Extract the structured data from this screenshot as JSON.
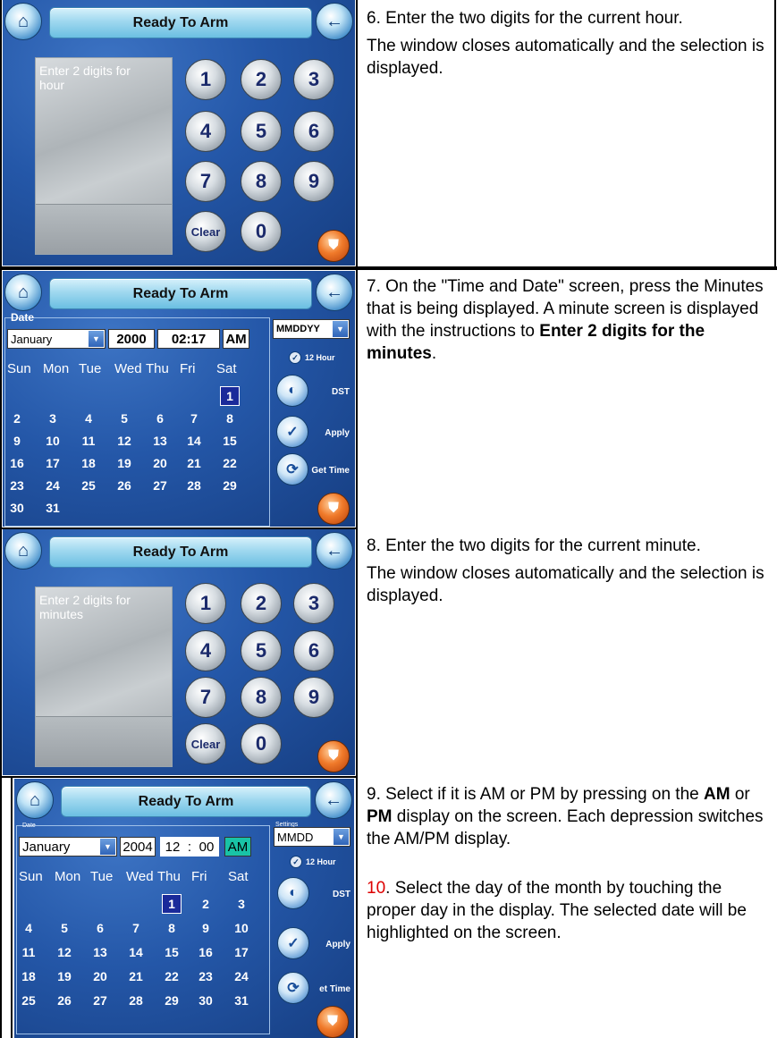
{
  "rows": [
    {
      "screen": {
        "title": "Ready To Arm",
        "prompt": "Enter 2 digits for hour",
        "keys": [
          "1",
          "2",
          "3",
          "4",
          "5",
          "6",
          "7",
          "8",
          "9",
          "Clear",
          "0"
        ]
      },
      "text": [
        "6. Enter the two digits for the current hour.",
        "The window closes automatically and the selection is displayed."
      ]
    },
    {
      "screen": {
        "title": "Ready To Arm",
        "date_caption": "Date",
        "month": "January",
        "year": "2000",
        "time": "02:17",
        "ampm": "AM",
        "format": "MMDDYY",
        "hour_mode": "12 Hour",
        "dow": [
          "Sun",
          "Mon",
          "Tue",
          "Wed",
          "Thu",
          "Fri",
          "Sat"
        ],
        "days": [
          "1",
          "2",
          "3",
          "4",
          "5",
          "6",
          "7",
          "8",
          "9",
          "10",
          "11",
          "12",
          "13",
          "14",
          "15",
          "16",
          "17",
          "18",
          "19",
          "20",
          "21",
          "22",
          "23",
          "24",
          "25",
          "26",
          "27",
          "28",
          "29",
          "30",
          "31"
        ],
        "selected_day": "1",
        "dst_label": "DST",
        "apply_label": "Apply",
        "get_time_label": "Get Time"
      },
      "text": {
        "part1": "7. On the \"Time and Date\" screen, press the Minutes that is being displayed.  A minute screen is displayed with the instructions to ",
        "bold": "Enter 2 digits for the minutes",
        "part2": "."
      }
    },
    {
      "screen": {
        "title": "Ready To Arm",
        "prompt": "Enter 2 digits for minutes",
        "keys": [
          "1",
          "2",
          "3",
          "4",
          "5",
          "6",
          "7",
          "8",
          "9",
          "Clear",
          "0"
        ]
      },
      "text": [
        "8. Enter the two digits for the current minute.",
        "The window closes automatically and the selection is displayed."
      ]
    },
    {
      "screen": {
        "title": "Ready To Arm",
        "date_caption": "Date",
        "settings_caption": "Settings",
        "month": "January",
        "year": "2004",
        "hour": "12",
        "minute": "00",
        "ampm": "AM",
        "format": "MMDD",
        "hour_mode": "12 Hour",
        "dow": [
          "Sun",
          "Mon",
          "Tue",
          "Wed",
          "Thu",
          "Fri",
          "Sat"
        ],
        "days": [
          "1",
          "2",
          "3",
          "4",
          "5",
          "6",
          "7",
          "8",
          "9",
          "10",
          "11",
          "12",
          "13",
          "14",
          "15",
          "16",
          "17",
          "18",
          "19",
          "20",
          "21",
          "22",
          "23",
          "24",
          "25",
          "26",
          "27",
          "28",
          "29",
          "30",
          "31"
        ],
        "selected_day": "1",
        "dst_label": "DST",
        "apply_label": "Apply",
        "get_time_label": "et Time"
      },
      "text": {
        "p1a": "9.  Select if it is AM or PM by pressing on the ",
        "am": "AM",
        "or": " or ",
        "pm": "PM",
        "p1b": " display on the screen. Each depression switches the AM/PM display.",
        "num10": "10",
        "p2": ". Select the day of the month by touching the proper day in the display. The selected date will be highlighted on the screen."
      }
    }
  ]
}
